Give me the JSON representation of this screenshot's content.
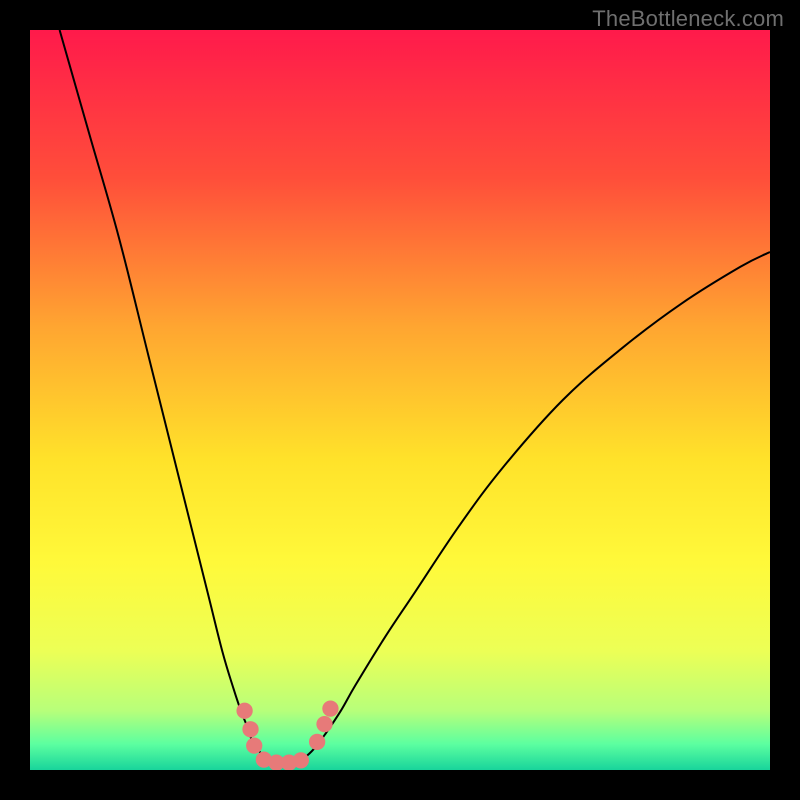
{
  "watermark": "TheBottleneck.com",
  "colors": {
    "frame": "#000000",
    "curve_stroke": "#000000",
    "dot_fill": "#e77a79",
    "gradient_stops": [
      {
        "offset": 0.0,
        "color": "#ff1a4b"
      },
      {
        "offset": 0.2,
        "color": "#ff4e3a"
      },
      {
        "offset": 0.4,
        "color": "#ffa531"
      },
      {
        "offset": 0.58,
        "color": "#ffe22a"
      },
      {
        "offset": 0.72,
        "color": "#fff93a"
      },
      {
        "offset": 0.84,
        "color": "#ecff56"
      },
      {
        "offset": 0.92,
        "color": "#b7ff7a"
      },
      {
        "offset": 0.965,
        "color": "#5cffa0"
      },
      {
        "offset": 1.0,
        "color": "#18d49b"
      }
    ]
  },
  "chart_data": {
    "type": "line",
    "title": "",
    "xlabel": "",
    "ylabel": "",
    "xlim": [
      0,
      100
    ],
    "ylim": [
      0,
      100
    ],
    "curve": [
      {
        "x": 4.0,
        "y": 100.0
      },
      {
        "x": 8.0,
        "y": 86.0
      },
      {
        "x": 12.0,
        "y": 72.0
      },
      {
        "x": 16.0,
        "y": 56.0
      },
      {
        "x": 20.0,
        "y": 40.0
      },
      {
        "x": 24.0,
        "y": 24.0
      },
      {
        "x": 26.0,
        "y": 16.0
      },
      {
        "x": 27.5,
        "y": 11.0
      },
      {
        "x": 28.5,
        "y": 8.0
      },
      {
        "x": 29.3,
        "y": 6.0
      },
      {
        "x": 30.0,
        "y": 4.0
      },
      {
        "x": 31.0,
        "y": 2.5
      },
      {
        "x": 32.0,
        "y": 1.5
      },
      {
        "x": 33.0,
        "y": 1.0
      },
      {
        "x": 34.3,
        "y": 0.8
      },
      {
        "x": 35.6,
        "y": 1.0
      },
      {
        "x": 37.0,
        "y": 1.6
      },
      {
        "x": 38.5,
        "y": 3.0
      },
      {
        "x": 40.0,
        "y": 5.0
      },
      {
        "x": 42.0,
        "y": 8.0
      },
      {
        "x": 44.0,
        "y": 11.5
      },
      {
        "x": 48.0,
        "y": 18.0
      },
      {
        "x": 52.0,
        "y": 24.0
      },
      {
        "x": 58.0,
        "y": 33.0
      },
      {
        "x": 64.0,
        "y": 41.0
      },
      {
        "x": 72.0,
        "y": 50.0
      },
      {
        "x": 80.0,
        "y": 57.0
      },
      {
        "x": 88.0,
        "y": 63.0
      },
      {
        "x": 96.0,
        "y": 68.0
      },
      {
        "x": 100.0,
        "y": 70.0
      }
    ],
    "dots": [
      {
        "x": 29.0,
        "y": 8.0,
        "r": 1.1
      },
      {
        "x": 29.8,
        "y": 5.5,
        "r": 1.1
      },
      {
        "x": 30.3,
        "y": 3.3,
        "r": 1.1
      },
      {
        "x": 31.6,
        "y": 1.4,
        "r": 1.1
      },
      {
        "x": 33.3,
        "y": 1.0,
        "r": 1.1
      },
      {
        "x": 35.0,
        "y": 1.0,
        "r": 1.1
      },
      {
        "x": 36.6,
        "y": 1.3,
        "r": 1.1
      },
      {
        "x": 38.8,
        "y": 3.8,
        "r": 1.1
      },
      {
        "x": 39.8,
        "y": 6.2,
        "r": 1.1
      },
      {
        "x": 40.6,
        "y": 8.3,
        "r": 1.1
      }
    ]
  }
}
